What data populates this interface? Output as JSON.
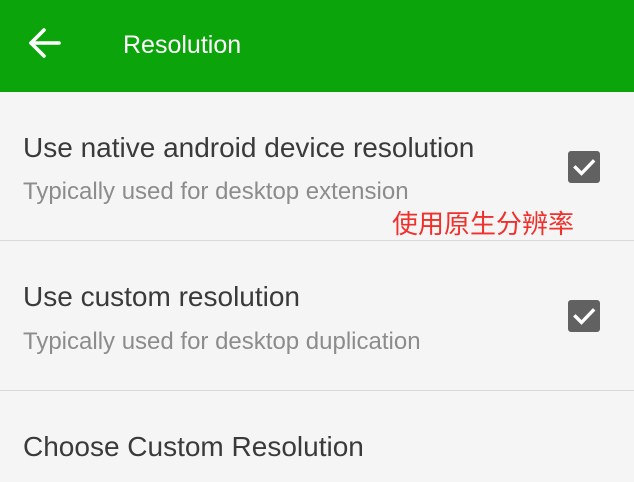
{
  "colors": {
    "app_bar_background": "#0ba40b",
    "app_bar_text": "#ffffff",
    "checkbox_fill": "#616161",
    "annotation_text": "#f0302b"
  },
  "app_bar": {
    "back_icon": "arrow-back-icon",
    "title": "Resolution"
  },
  "settings": {
    "items": [
      {
        "title": "Use native android device resolution",
        "summary": "Typically used for desktop extension",
        "checked": true,
        "checkbox_icon": "check-icon"
      },
      {
        "title": "Use custom resolution",
        "summary": "Typically used for desktop duplication",
        "checked": true,
        "checkbox_icon": "check-icon"
      },
      {
        "title": "Choose Custom Resolution"
      }
    ]
  },
  "annotation": {
    "text": "使用原生分辨率"
  }
}
